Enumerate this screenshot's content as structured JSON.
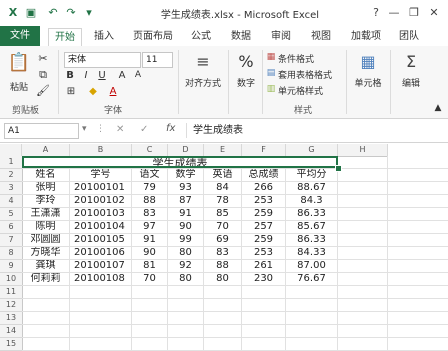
{
  "window": {
    "title": "学生成绩表.xlsx - Microsoft Excel",
    "help": "?",
    "minimize": "—",
    "restore": "❐",
    "close": "✕"
  },
  "tabs": [
    "文件",
    "开始",
    "插入",
    "页面布局",
    "公式",
    "数据",
    "审阅",
    "视图",
    "加载项",
    "团队"
  ],
  "ribbon": {
    "paste": "粘贴",
    "clipboard": "剪贴板",
    "font_name": "宋体",
    "font_size": "11",
    "font_group": "字体",
    "align": "对齐方式",
    "number": "数字",
    "number_symbol": "%",
    "conditional": "条件格式",
    "table_format": "套用表格格式",
    "cell_style": "单元格样式",
    "styles_group": "样式",
    "cells": "单元格",
    "edit": "编辑"
  },
  "formula_bar": {
    "name_box": "A1",
    "fx": "fx",
    "content": "学生成绩表"
  },
  "grid": {
    "columns": [
      "A",
      "B",
      "C",
      "D",
      "E",
      "F",
      "G",
      "H"
    ],
    "rows": [
      "1",
      "2",
      "3",
      "4",
      "5",
      "6",
      "7",
      "8",
      "9",
      "10",
      "11",
      "12",
      "13",
      "14",
      "15"
    ],
    "title": "学生成绩表",
    "headers": [
      "姓名",
      "学号",
      "语文",
      "数学",
      "英语",
      "总成绩",
      "平均分"
    ],
    "data": [
      [
        "张明",
        "20100101",
        "79",
        "93",
        "84",
        "266",
        "88.67"
      ],
      [
        "李玲",
        "20100102",
        "88",
        "87",
        "78",
        "253",
        "84.3"
      ],
      [
        "王潇潇",
        "20100103",
        "83",
        "91",
        "85",
        "259",
        "86.33"
      ],
      [
        "陈明",
        "20100104",
        "97",
        "90",
        "70",
        "257",
        "85.67"
      ],
      [
        "邓圆圆",
        "20100105",
        "91",
        "99",
        "69",
        "259",
        "86.33"
      ],
      [
        "方晓华",
        "20100106",
        "90",
        "80",
        "83",
        "253",
        "84.33"
      ],
      [
        "龚琪",
        "20100107",
        "81",
        "92",
        "88",
        "261",
        "87.00"
      ],
      [
        "何莉莉",
        "20100108",
        "70",
        "80",
        "80",
        "230",
        "76.67"
      ]
    ]
  }
}
